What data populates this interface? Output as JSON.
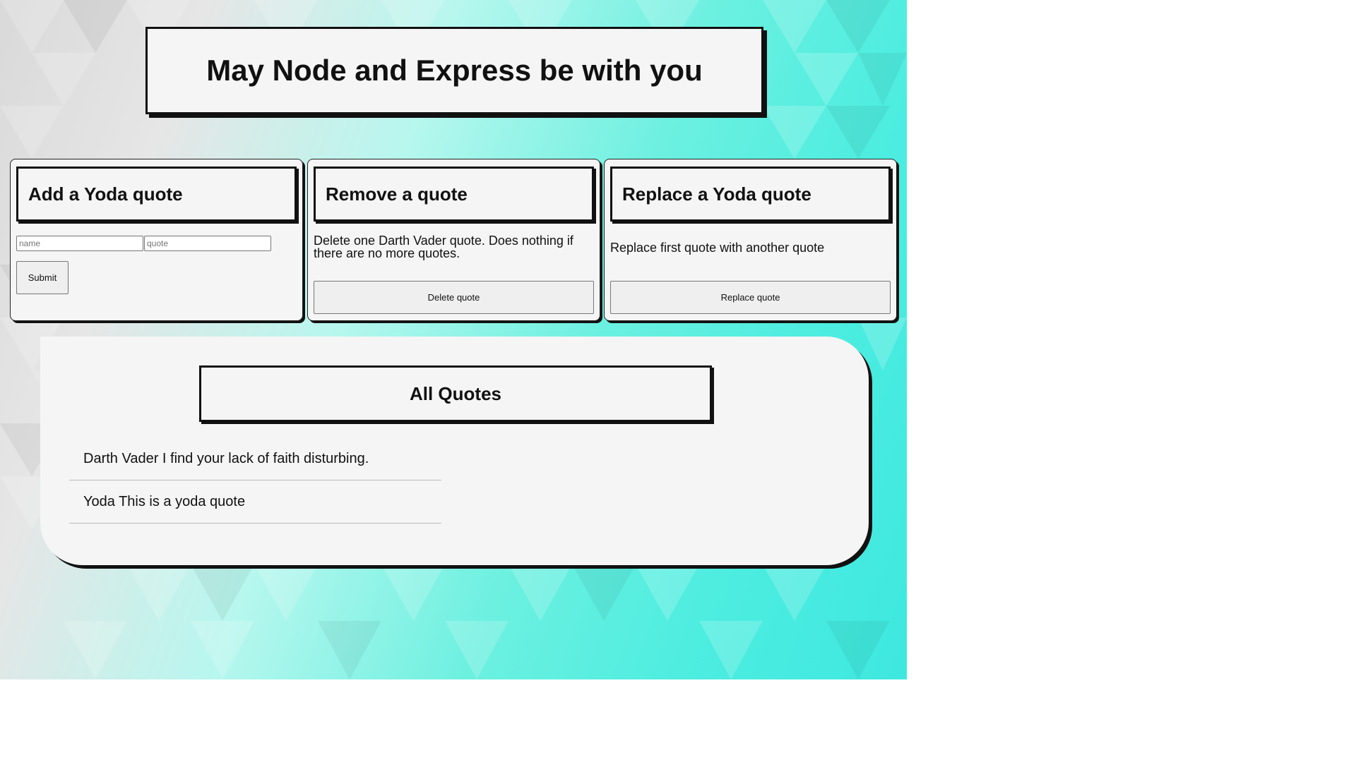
{
  "title": "May Node and Express be with you",
  "add_panel": {
    "heading": "Add a Yoda quote",
    "name_placeholder": "name",
    "quote_placeholder": "quote",
    "submit_label": "Submit"
  },
  "remove_panel": {
    "heading": "Remove a quote",
    "description": "Delete one Darth Vader quote. Does nothing if there are no more quotes.",
    "button_label": "Delete quote"
  },
  "replace_panel": {
    "heading": "Replace a Yoda quote",
    "description": "Replace first quote with another quote",
    "button_label": "Replace quote"
  },
  "quotes": {
    "heading": "All Quotes",
    "items": [
      "Darth Vader I find your lack of faith disturbing.",
      "Yoda This is a yoda quote"
    ]
  }
}
